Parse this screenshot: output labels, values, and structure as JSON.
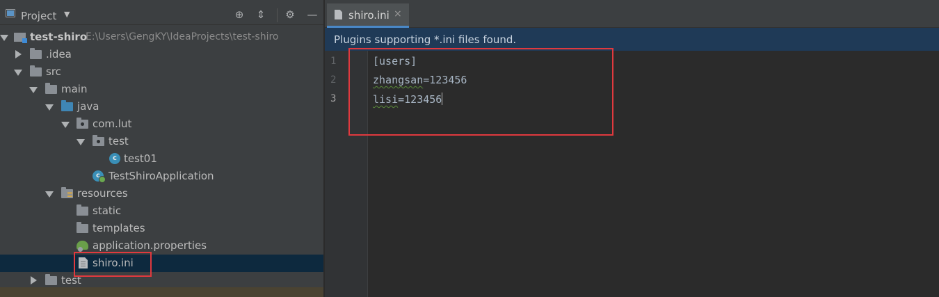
{
  "project_panel": {
    "title": "Project",
    "header_icons": [
      "locate-icon",
      "collapse-all-icon",
      "gear-icon",
      "hide-icon"
    ]
  },
  "tree": {
    "root": {
      "name": "test-shiro",
      "path": "E:\\Users\\GengKY\\IdeaProjects\\test-shiro"
    },
    "idea": ".idea",
    "src": "src",
    "main": "main",
    "java": "java",
    "pkg_com_lut": "com.lut",
    "pkg_test": "test",
    "class_test01": "test01",
    "class_app": "TestShiroApplication",
    "resources": "resources",
    "static": "static",
    "templates": "templates",
    "app_props": "application.properties",
    "shiro_ini": "shiro.ini",
    "test_dir": "test",
    "class_letter": "c"
  },
  "editor": {
    "tab_label": "shiro.ini",
    "tab_close": "×",
    "banner": "Plugins supporting *.ini files found.",
    "line_numbers": [
      "1",
      "2",
      "3"
    ],
    "lines": {
      "l1": "[users]",
      "l2_key": "zhangsan",
      "l2_rest": "=123456",
      "l3_key": "lisi",
      "l3_rest": "=123456"
    }
  },
  "colors": {
    "selection": "#0d293e",
    "banner": "#1f3a57",
    "highlight": "#e0393e",
    "tab_underline": "#4a88c7"
  }
}
